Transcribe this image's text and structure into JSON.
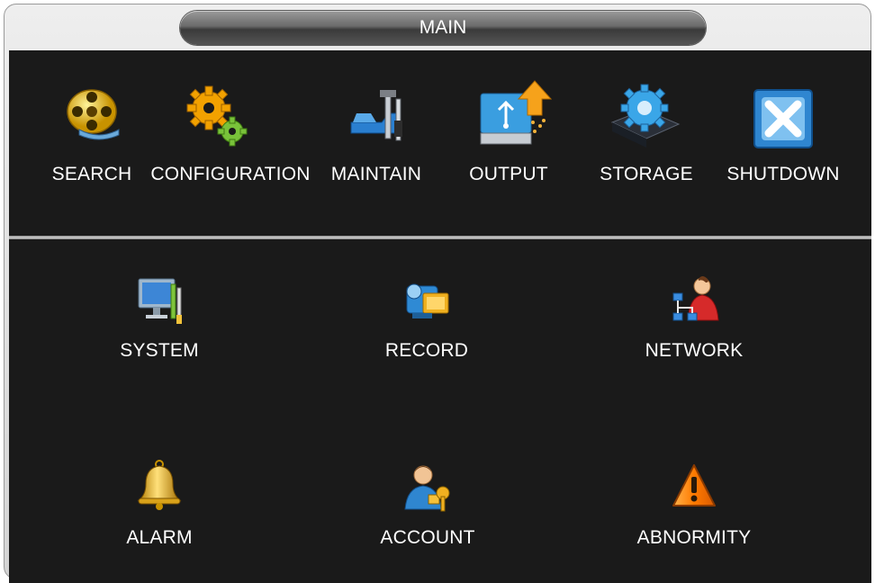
{
  "window": {
    "title": "MAIN"
  },
  "main_menu": [
    {
      "id": "search",
      "label": "SEARCH",
      "icon": "film-reel-icon"
    },
    {
      "id": "configuration",
      "label": "CONFIGURATION",
      "icon": "gears-icon"
    },
    {
      "id": "maintain",
      "label": "MAINTAIN",
      "icon": "tools-icon"
    },
    {
      "id": "output",
      "label": "OUTPUT",
      "icon": "usb-drive-upload-icon"
    },
    {
      "id": "storage",
      "label": "STORAGE",
      "icon": "disk-gear-icon"
    },
    {
      "id": "shutdown",
      "label": "SHUTDOWN",
      "icon": "shutdown-x-icon"
    }
  ],
  "sub_menu": [
    {
      "id": "system",
      "label": "SYSTEM",
      "icon": "monitor-tools-icon"
    },
    {
      "id": "record",
      "label": "RECORD",
      "icon": "camcorder-icon"
    },
    {
      "id": "network",
      "label": "NETWORK",
      "icon": "network-user-icon"
    },
    {
      "id": "alarm",
      "label": "ALARM",
      "icon": "bell-icon"
    },
    {
      "id": "account",
      "label": "ACCOUNT",
      "icon": "user-key-icon"
    },
    {
      "id": "abnormity",
      "label": "ABNORMITY",
      "icon": "warning-triangle-icon"
    }
  ],
  "colors": {
    "panel_bg": "#1a1a1a",
    "window_bg": "#dedede",
    "text": "#ffffff"
  }
}
